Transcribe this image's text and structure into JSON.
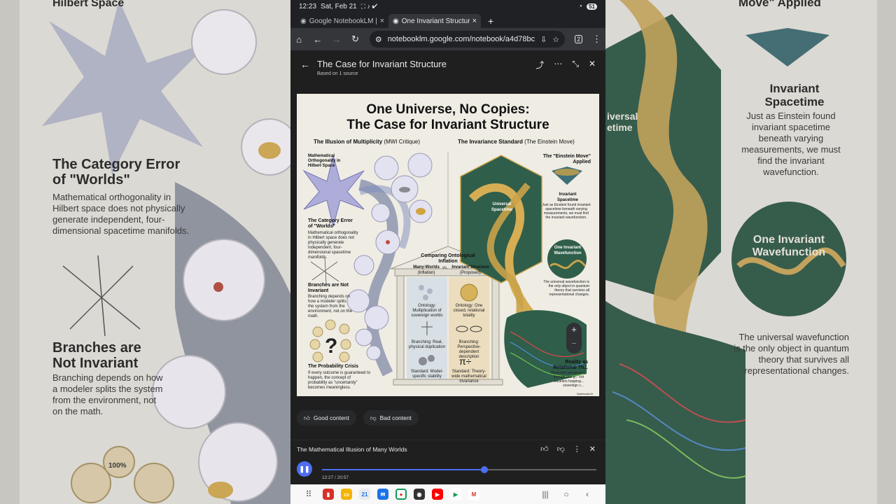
{
  "status": {
    "time": "12:23",
    "date": "Sat, Feb 21",
    "battery": "51"
  },
  "tabs": [
    {
      "label": "Google NotebookLM | A",
      "active": false
    },
    {
      "label": "One Invariant Structure",
      "active": true
    }
  ],
  "url": "notebooklm.google.com/notebook/a4d78bc",
  "url_tab_count": "2",
  "header": {
    "title": "The Case for Invariant Structure",
    "subtitle": "Based on 1 source"
  },
  "infographic": {
    "title_line1": "One Universe, No Copies:",
    "title_line2": "The Case for Invariant Structure",
    "left_heading": "The Illusion of Multiplicity",
    "left_heading_note": "(MWI Critique)",
    "right_heading": "The Invariance Standard",
    "right_heading_note": "(The Einstein Move)",
    "hilbert_label": "Mathematical Orthogonality in Hilbert Space",
    "category_title": "The Category Error of \"Worlds\"",
    "category_body": "Mathematical orthogonality in Hilbert space does not physically generate independent, four-dimensional spacetime manifolds.",
    "branches_title": "Branches are Not Invariant",
    "branches_body": "Branching depends on how a modeler splits the system from the environment, not on the math.",
    "probability_title": "The Probability Crisis",
    "probability_body": "If every outcome is guaranteed to happen, the concept of probability as \"uncertainty\" becomes meaningless.",
    "center_title": "Comparing Ontological Inflation",
    "mw_label": "Many-Worlds",
    "mw_note": "(Inflation)",
    "vs": "vs.",
    "is_label": "Invariant Structure",
    "is_note": "(Proposed)",
    "mw_ontology": "Ontology: Multiplication of sovereign worlds",
    "mw_branching": "Branching: Real, physical duplication",
    "mw_standard": "Standard: Model-specific stability",
    "is_ontology": "Ontology: One closed, relational totality",
    "is_branching": "Branching: Perspective-dependent description",
    "is_standard": "Standard: Theory-wide mathematical invariance",
    "pi_symbol": "π÷",
    "universal_spacetime": "Universal Spacetime",
    "einstein_move": "The \"Einstein Move\" Applied",
    "invariant_spacetime": "Invariant Spacetime",
    "invariant_spacetime_body": "Just as Einstein found invariant spacetime beneath varying measurements, we must find the invariant wavefunction.",
    "one_wavefunction": "One Invariant Wavefunction",
    "wavefunction_body": "The universal wavefunction is the only object in quantum theory that survives all representational changes.",
    "reality_title": "Reality as Relational Th...",
    "reality_body": "Observers are woven through one g... not travelers hopping... sovereign c...",
    "percent": "100%",
    "watermark": "NotebookLM"
  },
  "feedback": {
    "good": "Good content",
    "bad": "Bad content"
  },
  "player": {
    "title": "The Mathematical Illusion of Many Worlds",
    "current": "12:27",
    "total": "20:57",
    "progress": 0.593
  },
  "background": {
    "left_top": "Hilbert Space",
    "left_cat_title": "The Category Error of \"Worlds\"",
    "left_cat_body": "Mathematical orthogonality in Hilbert space does not physically generate independent, four-dimensional spacetime manifolds.",
    "left_branch_title": "Branches are Not Invariant",
    "left_branch_body": "Branching depends on how a modeler splits the system from the environment, not on the math.",
    "left_percent": "100%",
    "right_top": "Move\" Applied",
    "right_inv_title": "Invariant Spacetime",
    "right_inv_body": "Just as Einstein found invariant spacetime beneath varying measurements, we must find the invariant wavefunction.",
    "right_wave": "One Invariant Wavefunction",
    "right_wave_body": "The universal wavefunction is the only object in quantum theory that survives all representational changes.",
    "right_frag": "iversal etime"
  },
  "colors": {
    "accent": "#4e6ef2",
    "surface": "#1f1f1f",
    "toolbar": "#35363a",
    "paper": "#efece4",
    "gold": "#c9a24a",
    "green": "#2f5e4a"
  }
}
